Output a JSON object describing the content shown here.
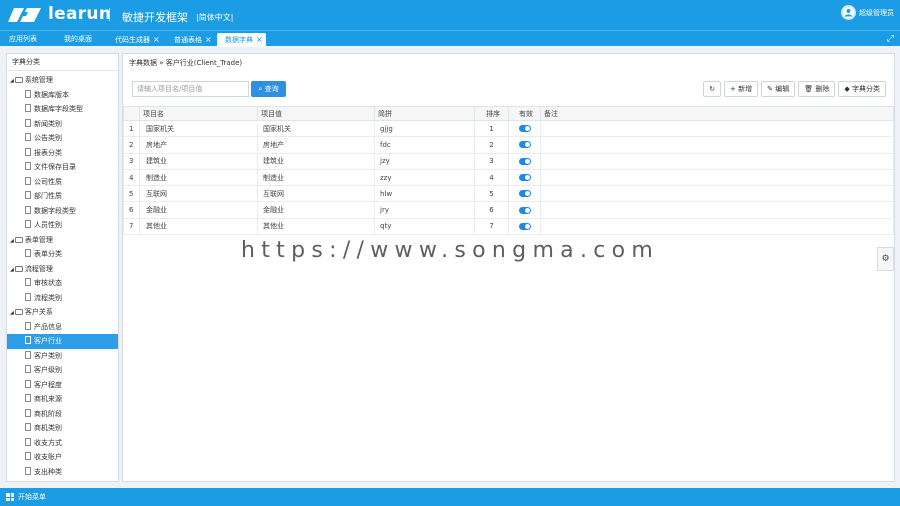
{
  "header": {
    "brand": "learun",
    "slogan": "敏捷开发框架",
    "slogan_sub": "|简体中文|",
    "user": "超级管理员",
    "icons": {
      "logo": "learun-logo-icon",
      "avatar": "user-avatar-icon",
      "fullscreen": "fullscreen-icon"
    }
  },
  "tabs": [
    {
      "label": "应用列表",
      "closable": false,
      "active": false
    },
    {
      "label": "我的桌面",
      "closable": false,
      "active": false
    },
    {
      "label": "代码生成器",
      "closable": true,
      "active": false
    },
    {
      "label": "普通表格",
      "closable": true,
      "active": false
    },
    {
      "label": "数据字典",
      "closable": true,
      "active": true
    }
  ],
  "sidebar": {
    "title": "字典分类",
    "tree": [
      {
        "label": "系统管理",
        "type": "group"
      },
      {
        "label": "数据库版本",
        "type": "leaf"
      },
      {
        "label": "数据库字段类型",
        "type": "leaf"
      },
      {
        "label": "新闻类别",
        "type": "leaf"
      },
      {
        "label": "公告类别",
        "type": "leaf"
      },
      {
        "label": "报表分类",
        "type": "leaf"
      },
      {
        "label": "文件保存目录",
        "type": "leaf"
      },
      {
        "label": "公司性质",
        "type": "leaf"
      },
      {
        "label": "部门性质",
        "type": "leaf"
      },
      {
        "label": "数据字段类型",
        "type": "leaf"
      },
      {
        "label": "人员性别",
        "type": "leaf"
      },
      {
        "label": "表单管理",
        "type": "group"
      },
      {
        "label": "表单分类",
        "type": "leaf"
      },
      {
        "label": "流程管理",
        "type": "group"
      },
      {
        "label": "审核状态",
        "type": "leaf"
      },
      {
        "label": "流程类别",
        "type": "leaf"
      },
      {
        "label": "客户关系",
        "type": "group"
      },
      {
        "label": "产品信息",
        "type": "leaf"
      },
      {
        "label": "客户行业",
        "type": "leaf",
        "selected": true
      },
      {
        "label": "客户类别",
        "type": "leaf"
      },
      {
        "label": "客户级别",
        "type": "leaf"
      },
      {
        "label": "客户程度",
        "type": "leaf"
      },
      {
        "label": "商机来源",
        "type": "leaf"
      },
      {
        "label": "商机阶段",
        "type": "leaf"
      },
      {
        "label": "商机类别",
        "type": "leaf"
      },
      {
        "label": "收支方式",
        "type": "leaf"
      },
      {
        "label": "收支账户",
        "type": "leaf"
      },
      {
        "label": "支出种类",
        "type": "leaf"
      }
    ]
  },
  "main": {
    "breadcrumb": "字典数据 » 客户行业(Client_Trade)",
    "search_placeholder": "请输入项目名/项目值",
    "query_label": "查询",
    "toolbar": {
      "refresh_icon": "refresh-icon",
      "add": "新增",
      "edit": "编辑",
      "delete": "删除",
      "category": "字典分类"
    },
    "columns": [
      "",
      "项目名",
      "项目值",
      "简拼",
      "排序",
      "有效",
      "备注"
    ],
    "rows": [
      {
        "no": "1",
        "name": "国家机关",
        "value": "国家机关",
        "py": "gjjg",
        "order": "1",
        "valid": true,
        "note": ""
      },
      {
        "no": "2",
        "name": "房地产",
        "value": "房地产",
        "py": "fdc",
        "order": "2",
        "valid": true,
        "note": ""
      },
      {
        "no": "3",
        "name": "建筑业",
        "value": "建筑业",
        "py": "jzy",
        "order": "3",
        "valid": true,
        "note": ""
      },
      {
        "no": "4",
        "name": "制造业",
        "value": "制造业",
        "py": "zzy",
        "order": "4",
        "valid": true,
        "note": ""
      },
      {
        "no": "5",
        "name": "互联网",
        "value": "互联网",
        "py": "hlw",
        "order": "5",
        "valid": true,
        "note": ""
      },
      {
        "no": "6",
        "name": "金融业",
        "value": "金融业",
        "py": "jry",
        "order": "6",
        "valid": true,
        "note": ""
      },
      {
        "no": "7",
        "name": "其他业",
        "value": "其他业",
        "py": "qty",
        "order": "7",
        "valid": true,
        "note": ""
      }
    ]
  },
  "watermark": "https://www.songma.com",
  "taskbar": {
    "start": "开始菜单",
    "icon": "windows-start-icon"
  },
  "colors": {
    "primary": "#1c9ce4",
    "selected": "#2f9ee8",
    "switch_on": "#1e88e5"
  }
}
